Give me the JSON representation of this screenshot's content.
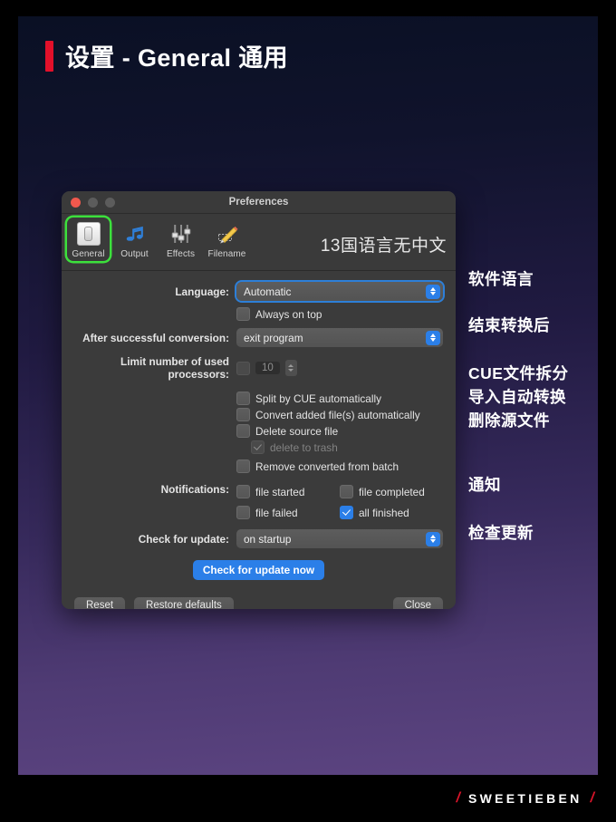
{
  "page": {
    "title": "设置 - General 通用",
    "accent_red": "#e3102a",
    "bg_top": "#0a1024",
    "bg_bottom": "#5c4481"
  },
  "window": {
    "title": "Preferences",
    "traffic_lights": [
      "close-light",
      "minimize-light",
      "maximize-light"
    ],
    "highlight_color": "#3ce03c"
  },
  "toolbar": {
    "items": [
      {
        "label": "General",
        "icon": "general-icon",
        "selected": true
      },
      {
        "label": "Output",
        "icon": "music-note-icon",
        "selected": false
      },
      {
        "label": "Effects",
        "icon": "sliders-icon",
        "selected": false
      },
      {
        "label": "Filename",
        "icon": "pencil-edit-icon",
        "selected": false
      }
    ],
    "note": "13国语言无中文"
  },
  "form": {
    "language_label": "Language:",
    "language_value": "Automatic",
    "always_on_top_label": "Always on top",
    "always_on_top_checked": false,
    "after_conversion_label": "After successful conversion:",
    "after_conversion_value": "exit program",
    "limit_processors_label": "Limit number of used processors:",
    "limit_processors_checked": false,
    "limit_processors_value": "10",
    "options": [
      {
        "label": "Split by CUE automatically",
        "checked": false,
        "disabled": false
      },
      {
        "label": "Convert added file(s) automatically",
        "checked": false,
        "disabled": false
      },
      {
        "label": "Delete source file",
        "checked": false,
        "disabled": false
      },
      {
        "label": "delete to trash",
        "checked": true,
        "disabled": true
      },
      {
        "label": "Remove converted from batch",
        "checked": false,
        "disabled": false
      }
    ],
    "notifications_label": "Notifications:",
    "notifications": [
      {
        "label": "file started",
        "checked": false
      },
      {
        "label": "file completed",
        "checked": false
      },
      {
        "label": "file failed",
        "checked": false
      },
      {
        "label": "all finished",
        "checked": true
      }
    ],
    "check_update_label": "Check for update:",
    "check_update_value": "on startup",
    "check_update_now_label": "Check for update now"
  },
  "footer": {
    "reset_label": "Reset",
    "restore_defaults_label": "Restore defaults",
    "close_label": "Close"
  },
  "annotations": [
    "软件语言",
    "结束转换后",
    "CUE文件拆分",
    "导入自动转换",
    "删除源文件",
    "通知",
    "检查更新"
  ],
  "watermark": {
    "left_slash": "/",
    "text": "SWEETIEBEN",
    "right_slash": "/"
  }
}
